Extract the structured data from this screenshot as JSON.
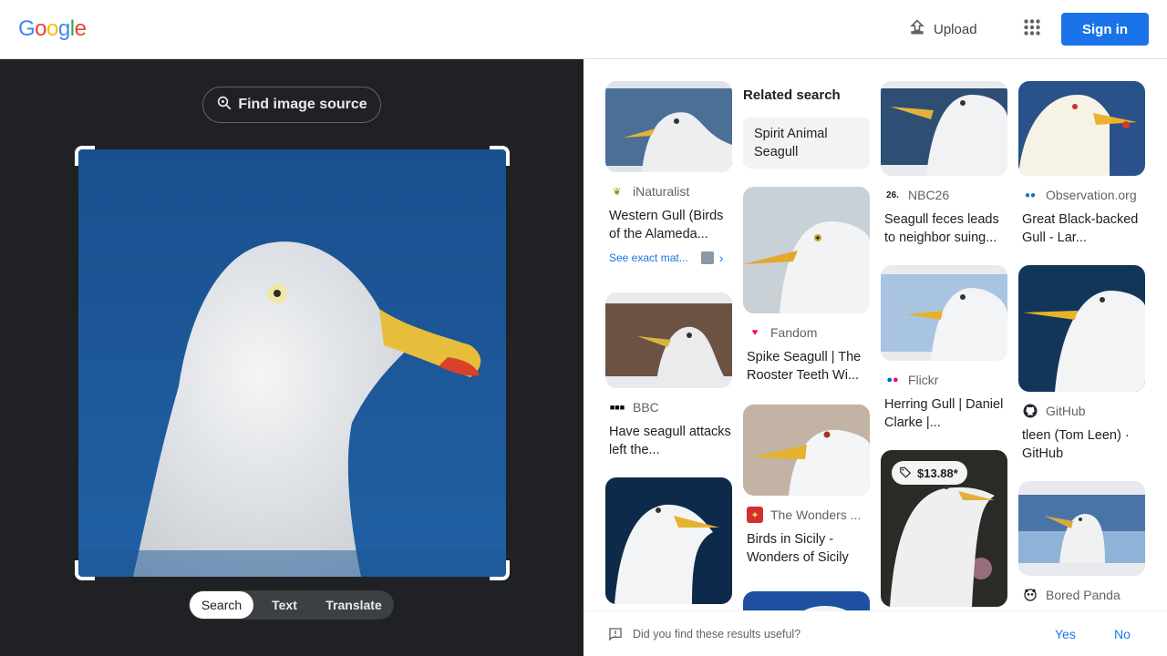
{
  "header": {
    "logo_letters": [
      {
        "ch": "G",
        "color": "#4285F4"
      },
      {
        "ch": "o",
        "color": "#EA4335"
      },
      {
        "ch": "o",
        "color": "#FBBC05"
      },
      {
        "ch": "g",
        "color": "#4285F4"
      },
      {
        "ch": "l",
        "color": "#34A853"
      },
      {
        "ch": "e",
        "color": "#EA4335"
      }
    ],
    "upload_label": "Upload",
    "signin_label": "Sign in",
    "accent_color": "#1a73e8"
  },
  "left": {
    "find_source_label": "Find image source",
    "tabs": [
      {
        "label": "Search",
        "active": true
      },
      {
        "label": "Text",
        "active": false
      },
      {
        "label": "Translate",
        "active": false
      }
    ]
  },
  "results": {
    "related_heading": "Related search",
    "related_chip": "Spirit Animal Seagull",
    "cards": [
      {
        "source": "iNaturalist",
        "title": "Western Gull (Birds of the Alameda...",
        "exact_match": "See exact mat...",
        "icon": "inaturalist-icon"
      },
      {
        "source": "BBC",
        "title": "Have seagull attacks left the...",
        "icon": "bbc-icon"
      },
      {
        "source": "",
        "title": "",
        "icon": ""
      },
      {
        "source": "Fandom",
        "title": "Spike Seagull | The Rooster Teeth Wi...",
        "icon": "fandom-icon"
      },
      {
        "source": "The Wonders ...",
        "title": "Birds in Sicily - Wonders of Sicily",
        "icon": "wonders-icon"
      },
      {
        "source": "NBC26",
        "title": "Seagull feces leads to neighbor suing...",
        "icon": "nbc26-icon"
      },
      {
        "source": "Flickr",
        "title": "Herring Gull | Daniel Clarke |...",
        "icon": "flickr-icon"
      },
      {
        "source": "",
        "title": "",
        "price": "$13.88*",
        "icon": ""
      },
      {
        "source": "Observation.org",
        "title": "Great Black-backed Gull - Lar...",
        "icon": "observation-icon"
      },
      {
        "source": "GitHub",
        "title": "tleen (Tom Leen) · GitHub",
        "icon": "github-icon"
      },
      {
        "source": "Bored Panda",
        "title": "",
        "icon": "boredpanda-icon"
      }
    ]
  },
  "feedback": {
    "question": "Did you find these results useful?",
    "yes": "Yes",
    "no": "No"
  }
}
